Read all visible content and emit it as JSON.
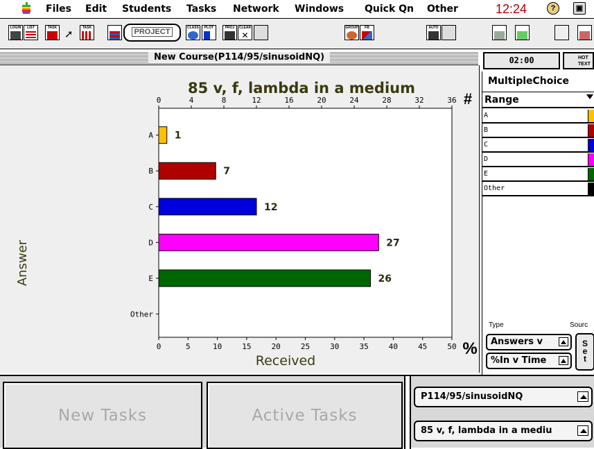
{
  "menubar": {
    "items": [
      "Files",
      "Edit",
      "Students",
      "Tasks",
      "Network",
      "Windows",
      "Quick Qn",
      "Other"
    ],
    "clock": "12:24"
  },
  "toolbar": {
    "buttons": [
      "LOGIN",
      "LIST",
      "TASK",
      "TASK",
      "CLASS",
      "PLOT",
      "PROJ",
      "CLEAR",
      "GROUP",
      "FB",
      "AUTO"
    ],
    "project_label": "PROJECT"
  },
  "window": {
    "title": "New Course(P114/95/sinusoidNQ)"
  },
  "chart_data": {
    "type": "bar",
    "orientation": "horizontal",
    "title": "85 v, f, lambda in a medium",
    "categories": [
      "A",
      "B",
      "C",
      "D",
      "E",
      "Other"
    ],
    "values": [
      1,
      7,
      12,
      27,
      26,
      0
    ],
    "value_labels": [
      "1",
      "7",
      "12",
      "27",
      "26",
      ""
    ],
    "colors": [
      "#ffc000",
      "#b00000",
      "#0000dd",
      "#ff00ff",
      "#006600",
      "#000000"
    ],
    "xlim_count": [
      0,
      36
    ],
    "count_ticks": [
      0,
      4,
      8,
      12,
      16,
      20,
      24,
      28,
      32,
      36
    ],
    "count_axis_symbol": "#",
    "xlim_percent": [
      0,
      50
    ],
    "percent_ticks": [
      0,
      5,
      10,
      15,
      20,
      25,
      30,
      35,
      40,
      45,
      50
    ],
    "percent_axis_symbol": "%",
    "xlabel": "Received",
    "ylabel": "Answer"
  },
  "right_panel": {
    "timer": "02:00",
    "hot_text": [
      "HOT",
      "TEXT"
    ],
    "mode_title": "MultipleChoice",
    "range_label": "Range",
    "legend": [
      {
        "label": "A",
        "color": "#ffc000"
      },
      {
        "label": "B",
        "color": "#b00000"
      },
      {
        "label": "C",
        "color": "#0000dd"
      },
      {
        "label": "D",
        "color": "#ff00ff"
      },
      {
        "label": "E",
        "color": "#006600"
      },
      {
        "label": "Other",
        "color": "#000000"
      }
    ],
    "type_label": "Type",
    "source_label": "Sourc",
    "type_select": "Answers v",
    "time_select": "%In v Time",
    "set_button": "Set"
  },
  "bottom": {
    "new_tasks": "New Tasks",
    "active_tasks": "Active Tasks",
    "course_select": "P114/95/sinusoidNQ",
    "question_select": "85 v, f, lambda in a mediu"
  }
}
